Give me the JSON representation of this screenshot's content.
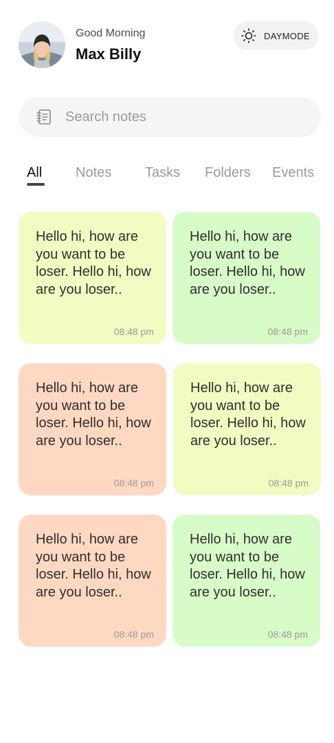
{
  "header": {
    "greeting": "Good Morning",
    "username": "Max Billy",
    "mode_label": "DAYMODE"
  },
  "search": {
    "placeholder": "Search notes"
  },
  "tabs": [
    {
      "label": "All",
      "active": true
    },
    {
      "label": "Notes",
      "active": false
    },
    {
      "label": "Tasks",
      "active": false
    },
    {
      "label": "Folders",
      "active": false
    },
    {
      "label": "Events",
      "active": false
    }
  ],
  "notes": [
    {
      "text": "Hello hi, how are you want to be loser. Hello hi, how are you loser..",
      "time": "08:48 pm",
      "color": "#f1fcc2"
    },
    {
      "text": "Hello hi, how are you want to be loser. Hello hi, how are you loser..",
      "time": "08:48 pm",
      "color": "#d8fcc8"
    },
    {
      "text": "Hello hi, how are you want to be loser. Hello hi, how are you loser..",
      "time": "08:48 pm",
      "color": "#ffd8c2"
    },
    {
      "text": "Hello hi, how are you want to be loser. Hello hi, how are you loser..",
      "time": "08:48 pm",
      "color": "#f1fcc2"
    },
    {
      "text": "Hello hi, how are you want to be loser. Hello hi, how are you loser..",
      "time": "08:48 pm",
      "color": "#ffd8c2"
    },
    {
      "text": "Hello hi, how are you want to be loser. Hello hi, how are you loser..",
      "time": "08:48 pm",
      "color": "#d8fcc8"
    }
  ]
}
